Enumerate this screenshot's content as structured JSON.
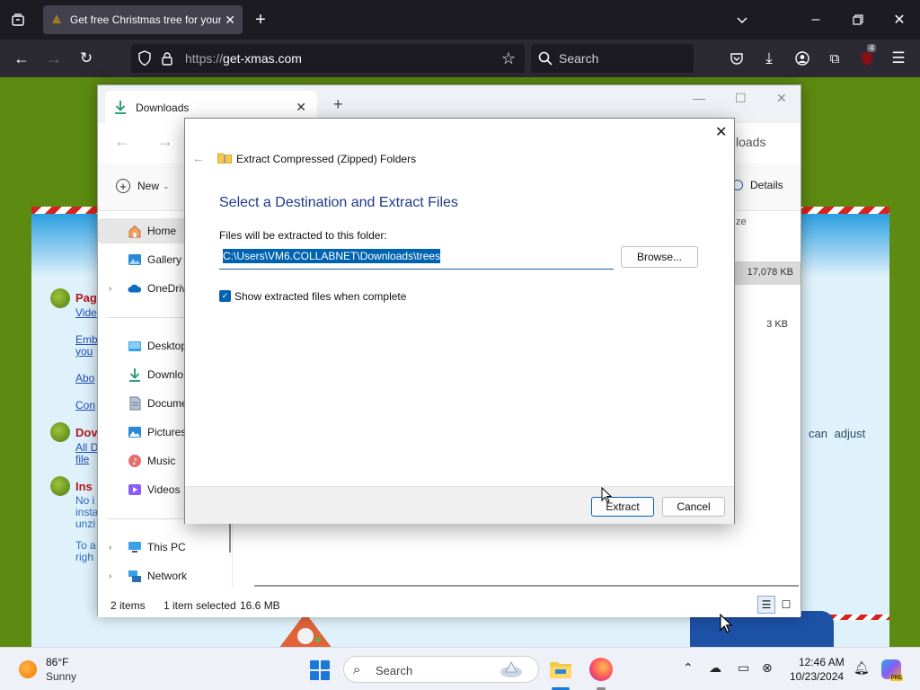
{
  "browser": {
    "tab_title": "Get free Christmas tree for your",
    "url_scheme": "https://",
    "url_host": "get-xmas.com",
    "search_placeholder": "Search",
    "extension_badge": "4"
  },
  "webpage": {
    "heading1": "Pag",
    "link1": "Vide",
    "link2a": "Emb",
    "link2b": "you",
    "link3": "Abo",
    "link4": "Con",
    "heading2": "Dov",
    "link5a": "All D",
    "link5b": "file",
    "heading3": "Ins",
    "text6a": "No i",
    "text6b": "insta",
    "text6c": "unzi",
    "link7a": "To a",
    "link7b": "righ",
    "adjust_text": "can adjust"
  },
  "explorer": {
    "tab_label": "Downloads",
    "address_tail": "loads",
    "new_label": "New",
    "details_label": "Details",
    "nav": [
      {
        "label": "Home",
        "icon": "home-icon"
      },
      {
        "label": "Gallery",
        "icon": "gallery-icon"
      },
      {
        "label": "OneDriv",
        "icon": "onedrive-icon"
      },
      {
        "label": "Desktop",
        "icon": "desktop-icon"
      },
      {
        "label": "Downlo",
        "icon": "download-icon"
      },
      {
        "label": "Docume",
        "icon": "document-icon"
      },
      {
        "label": "Pictures",
        "icon": "pictures-icon"
      },
      {
        "label": "Music",
        "icon": "music-icon"
      },
      {
        "label": "Videos",
        "icon": "videos-icon"
      },
      {
        "label": "This PC",
        "icon": "computer-icon"
      },
      {
        "label": "Network",
        "icon": "network-icon"
      }
    ],
    "size_header": "ze",
    "row1_size": "17,078 KB",
    "row2_size": "3 KB",
    "status_items": "2 items",
    "status_selected": "1 item selected",
    "status_size": "16.6 MB"
  },
  "dialog": {
    "window_title": "Extract Compressed (Zipped) Folders",
    "heading": "Select a Destination and Extract Files",
    "path_label": "Files will be extracted to this folder:",
    "path_value": "C:\\Users\\VM6.COLLABNET\\Downloads\\trees",
    "browse_label": "Browse...",
    "checkbox_label": "Show extracted files when complete",
    "checkbox_checked": true,
    "extract_label": "Extract",
    "cancel_label": "Cancel"
  },
  "taskbar": {
    "temperature": "86°F",
    "condition": "Sunny",
    "search_placeholder": "Search",
    "time": "12:46 AM",
    "date": "10/23/2024",
    "copilot_badge": "PRE"
  },
  "colors": {
    "accent": "#0063b1",
    "heading_blue": "#1e3a8a",
    "page_green": "#5d8a10"
  }
}
